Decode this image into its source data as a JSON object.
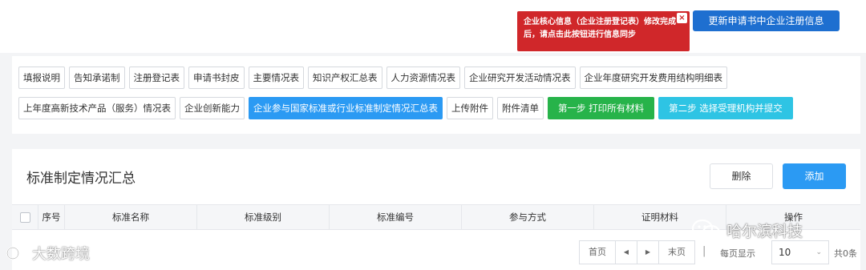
{
  "alert": {
    "message": "企业核心信息（企业注册登记表）修改完成后，请点击此按钮进行信息同步",
    "close_symbol": "×"
  },
  "sync_button": {
    "label": "更新申请书中企业注册信息"
  },
  "nav": {
    "row1": [
      "填报说明",
      "告知承诺制",
      "注册登记表",
      "申请书封皮",
      "主要情况表",
      "知识产权汇总表",
      "人力资源情况表",
      "企业研究开发活动情况表",
      "企业年度研究开发费用结构明细表"
    ],
    "row2": [
      "上年度高新技术产品（服务）情况表",
      "企业创新能力",
      "企业参与国家标准或行业标准制定情况汇总表",
      "上传附件",
      "附件清单"
    ],
    "active": "企业参与国家标准或行业标准制定情况汇总表",
    "step1": "第一步 打印所有材料",
    "step2": "第二步 选择受理机构并提交"
  },
  "main": {
    "title": "标准制定情况汇总",
    "delete_label": "删除",
    "add_label": "添加",
    "columns": [
      "序号",
      "标准名称",
      "标准级别",
      "标准编号",
      "参与方式",
      "证明材料",
      "操作"
    ]
  },
  "pager": {
    "first": "首页",
    "prev": "◀",
    "next": "▶",
    "last": "末页",
    "separator": "|",
    "per_page_label": "每页显示",
    "per_page_value": "10",
    "total": "共0条"
  },
  "watermarks": {
    "left": "大数跨境",
    "right": "哈尔滨科技"
  },
  "colors": {
    "primary": "#2b9af3",
    "alert": "#d0272a",
    "sync": "#1e6fd0",
    "step1": "#27b34a",
    "step2": "#2ec4e4"
  }
}
